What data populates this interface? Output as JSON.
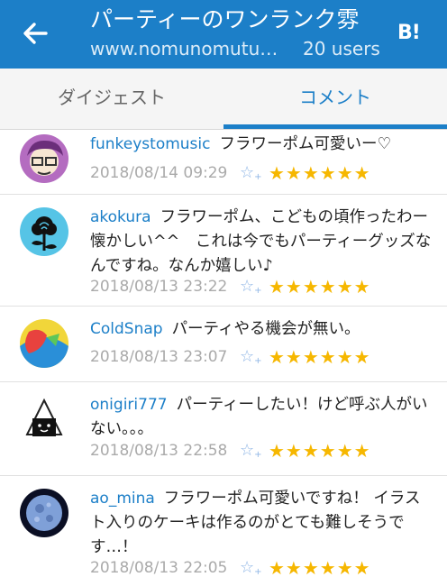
{
  "header": {
    "title": "パーティーのワンランク雰",
    "url": "www.nomunomutuk...",
    "users": "20 users",
    "hatena_logo": "B!",
    "back_icon": "arrow-left-icon"
  },
  "tabs": [
    {
      "label": "ダイジェスト"
    },
    {
      "label": "コメント"
    }
  ],
  "active_tab": 1,
  "comments": [
    {
      "user": "funkeystomusic",
      "text": "フラワーポム可愛いー♡",
      "date": "2018/08/14 09:29",
      "stars": "★★★★★★"
    },
    {
      "user": "akokura",
      "text": "フラワーポム、こどもの頃作ったわー　懐かしい^^　これは今でもパーティーグッズなんですね。なんか嬉しい♪",
      "date": "2018/08/13 23:22",
      "stars": "★★★★★★"
    },
    {
      "user": "ColdSnap",
      "text": "パーティやる機会が無い。",
      "date": "2018/08/13 23:07",
      "stars": "★★★★★★"
    },
    {
      "user": "onigiri777",
      "text": "パーティーしたい！けど呼ぶ人がいない。。。",
      "date": "2018/08/13 22:58",
      "stars": "★★★★★★"
    },
    {
      "user": "ao_mina",
      "text": "フラワーポム可愛いですね！ イラスト入りのケーキは作るのがとても難しそうです…！",
      "date": "2018/08/13 22:05",
      "stars": "★★★★★★"
    }
  ],
  "add_star_label": "☆+",
  "colors": {
    "primary": "#1c7fc8",
    "star": "#f6b700",
    "date": "#aaaaaa"
  }
}
